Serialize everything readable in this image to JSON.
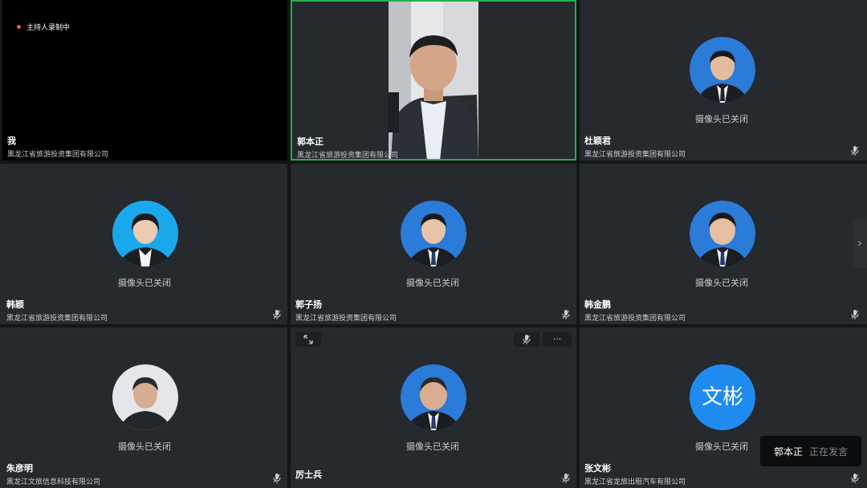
{
  "recording": {
    "label": "主持人录制中"
  },
  "camera_off_text": "摄像头已关闭",
  "speaker_toast": {
    "name": "郭本正",
    "status": "正在发言"
  },
  "tiles": [
    {
      "name": "我",
      "org": "黑龙江省旅游投资集团有限公司",
      "camera": "off-self"
    },
    {
      "name": "郭本正",
      "org": "黑龙江省旅游投资集团有限公司",
      "camera": "on",
      "speaking": true
    },
    {
      "name": "杜颖君",
      "org": "黑龙江省旅游投资集团有限公司",
      "camera": "off",
      "muted": true
    },
    {
      "name": "韩颖",
      "org": "黑龙江省旅游投资集团有限公司",
      "camera": "off",
      "muted": true
    },
    {
      "name": "郭子扬",
      "org": "黑龙江省旅游投资集团有限公司",
      "camera": "off",
      "muted": true
    },
    {
      "name": "韩金鹏",
      "org": "黑龙江省旅游投资集团有限公司",
      "camera": "off",
      "muted": true
    },
    {
      "name": "朱彦明",
      "org": "黑龙江文旅信息科技有限公司",
      "camera": "off",
      "muted": true
    },
    {
      "name": "厉士兵",
      "org": "",
      "camera": "off",
      "muted": true
    },
    {
      "name": "张文彬",
      "org": "黑龙江省龙旅出租汽车有限公司",
      "camera": "off",
      "muted": true,
      "initials": "文彬"
    }
  ],
  "hover_controls": {
    "more_label": "···"
  },
  "icons": {
    "mic_muted": "mic-muted-icon",
    "expand": "expand-icon",
    "more": "more-icon",
    "next": "chevron-right-icon"
  },
  "colors": {
    "speaking_border": "#22b14c",
    "record_dot": "#ff5a2a",
    "avatar_blue": "#1f8bf0"
  }
}
